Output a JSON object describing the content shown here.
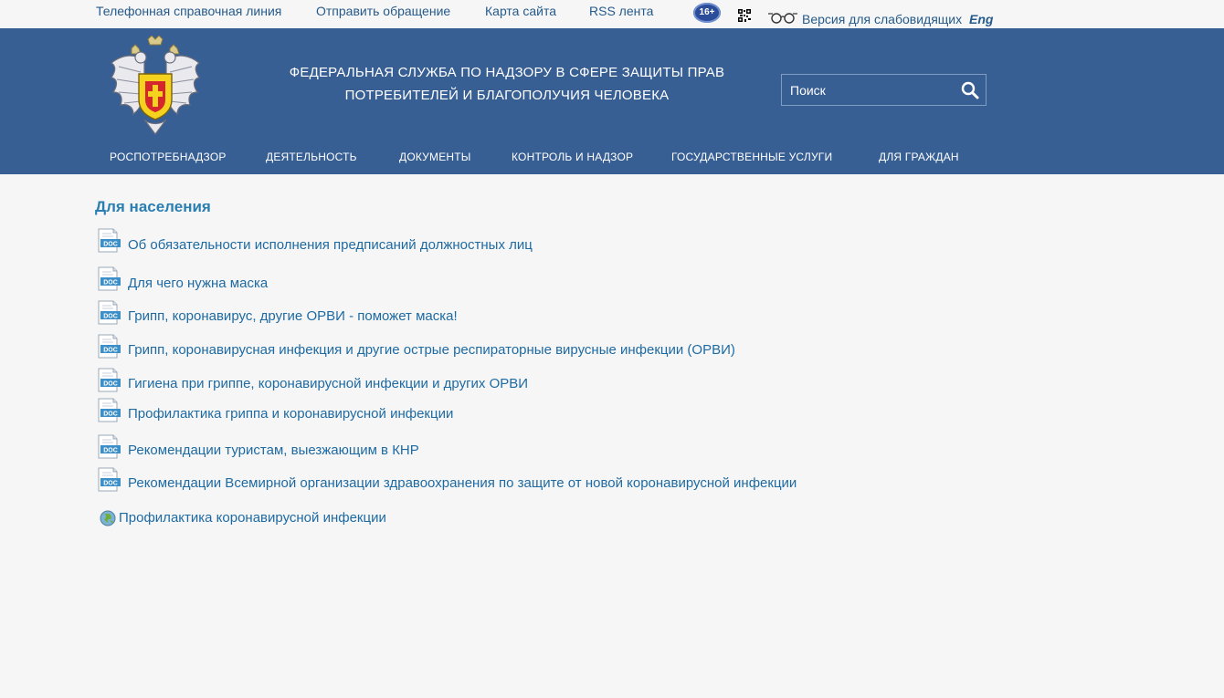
{
  "topbar": {
    "links": [
      "Телефонная справочная линия",
      "Отправить обращение",
      "Карта сайта",
      "RSS лента"
    ],
    "age_badge": "16+",
    "vision_label": "Версия для слабовидящих",
    "lang_label": "Eng"
  },
  "header": {
    "title_line1": "ФЕДЕРАЛЬНАЯ СЛУЖБА ПО НАДЗОРУ В СФЕРЕ ЗАЩИТЫ ПРАВ",
    "title_line2": "ПОТРЕБИТЕЛЕЙ И БЛАГОПОЛУЧИЯ ЧЕЛОВЕКА",
    "search_placeholder": "Поиск",
    "nav": [
      "РОСПОТРЕБНАДЗОР",
      "ДЕЯТЕЛЬНОСТЬ",
      "ДОКУМЕНТЫ",
      "КОНТРОЛЬ И НАДЗОР",
      "ГОСУДАРСТВЕННЫЕ УСЛУГИ",
      "ДЛЯ ГРАЖДАН"
    ]
  },
  "main": {
    "heading": "Для населения",
    "doc_icon_label": "DOC",
    "documents": [
      "Об обязательности исполнения предписаний должностных лиц",
      "Для чего нужна маска",
      "Грипп, коронавирус, другие ОРВИ - поможет маска!",
      "Грипп, коронавирусная инфекция и другие острые респираторные вирусные инфекции (ОРВИ)",
      "Гигиена при гриппе, коронавирусной инфекции и других ОРВИ",
      "Профилактика гриппа и коронавирусной инфекции",
      "Рекомендации туристам, выезжающим в КНР",
      "Рекомендации Всемирной организации здравоохранения по защите от новой коронавирусной инфекции"
    ],
    "web_link": "Профилактика коронавирусной инфекции"
  },
  "colors": {
    "header_bg": "#385f93",
    "link": "#1e6aa2",
    "heading": "#2a7eb0",
    "page_bg": "#f6f6f6"
  },
  "icons": {
    "age": "age-rating-icon",
    "qr": "qr-code-icon",
    "vision": "glasses-icon",
    "search": "search-icon",
    "document": "doc-file-icon",
    "web": "globe-icon",
    "emblem": "eagle-emblem-icon"
  }
}
